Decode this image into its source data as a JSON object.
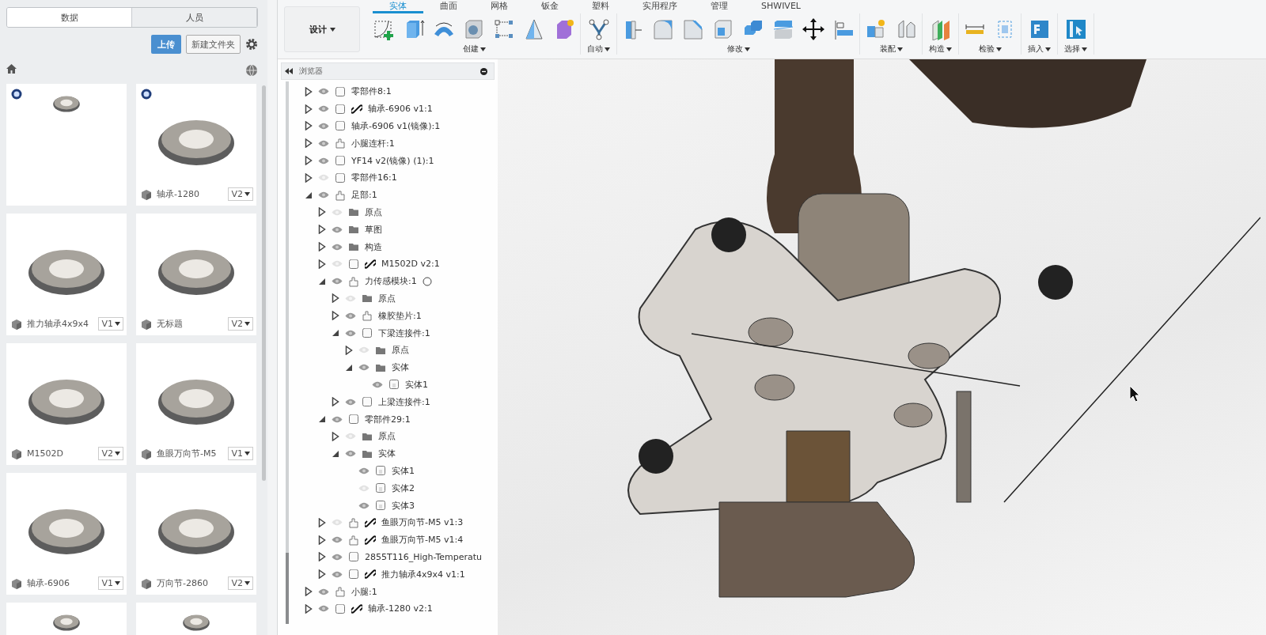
{
  "data_panel": {
    "tabs": [
      {
        "label": "数据",
        "selected": true
      },
      {
        "label": "人员",
        "selected": false
      }
    ],
    "upload_button": "上传",
    "new_folder_button": "新建文件夹",
    "cards": [
      {
        "badge": true
      },
      {
        "badge": true,
        "name": "轴承-1280",
        "version": "V2"
      },
      {
        "badge": false,
        "name": "推力轴承4x9x4",
        "version": "V1"
      },
      {
        "badge": false,
        "name": "无标题",
        "version": "V2"
      },
      {
        "badge": false,
        "name": "M1502D",
        "version": "V2"
      },
      {
        "badge": false,
        "name": "鱼眼万向节-M5",
        "version": "V1"
      },
      {
        "badge": false,
        "name": "轴承-6906",
        "version": "V1"
      },
      {
        "badge": false,
        "name": "万向节-2860",
        "version": "V2"
      },
      {
        "badge": false
      },
      {
        "badge": false
      }
    ]
  },
  "toolbar": {
    "workspace": "设计",
    "tabs": [
      {
        "label": "实体",
        "selected": true
      },
      {
        "label": "曲面",
        "selected": false
      },
      {
        "label": "网格",
        "selected": false
      },
      {
        "label": "钣金",
        "selected": false
      },
      {
        "label": "塑料",
        "selected": false
      },
      {
        "label": "实用程序",
        "selected": false
      },
      {
        "label": "管理",
        "selected": false
      },
      {
        "label": "SHWIVEL",
        "selected": false
      }
    ],
    "groups": [
      {
        "label": "创建"
      },
      {
        "label": "自动"
      },
      {
        "label": "修改"
      },
      {
        "label": "装配"
      },
      {
        "label": "构造"
      },
      {
        "label": "检验"
      },
      {
        "label": "插入"
      },
      {
        "label": "选择"
      }
    ]
  },
  "browser": {
    "title": "浏览器",
    "tree": [
      {
        "label": "零部件8:1",
        "kind": "body",
        "visible": true,
        "link": false,
        "expanded": false
      },
      {
        "label": "轴承-6906 v1:1",
        "kind": "body",
        "visible": true,
        "link": true,
        "expanded": false
      },
      {
        "label": "轴承-6906 v1(镜像):1",
        "kind": "body",
        "visible": true,
        "link": false,
        "expanded": false
      },
      {
        "label": "小腿连杆:1",
        "kind": "component",
        "visible": true,
        "link": false,
        "expanded": false
      },
      {
        "label": "YF14 v2(镜像) (1):1",
        "kind": "body",
        "visible": true,
        "link": false,
        "expanded": false
      },
      {
        "label": "零部件16:1",
        "kind": "body",
        "visible": false,
        "link": false,
        "expanded": false
      },
      {
        "label": "足部:1",
        "kind": "component",
        "visible": true,
        "link": false,
        "expanded": true,
        "children": [
          {
            "label": "原点",
            "kind": "folder",
            "visible": false,
            "link": false,
            "expanded": false
          },
          {
            "label": "草图",
            "kind": "folder",
            "visible": true,
            "link": false,
            "expanded": false
          },
          {
            "label": "构造",
            "kind": "folder",
            "visible": true,
            "link": false,
            "expanded": false
          },
          {
            "label": "M1502D v2:1",
            "kind": "body",
            "visible": false,
            "link": true,
            "expanded": false
          },
          {
            "label": "力传感模块:1",
            "kind": "component",
            "visible": true,
            "link": false,
            "expanded": true,
            "activated": false,
            "children": [
              {
                "label": "原点",
                "kind": "folder",
                "visible": false,
                "link": false,
                "expanded": false
              },
              {
                "label": "橡胶垫片:1",
                "kind": "component",
                "visible": true,
                "link": false,
                "expanded": false
              },
              {
                "label": "下梁连接件:1",
                "kind": "body",
                "visible": true,
                "link": false,
                "expanded": true,
                "children": [
                  {
                    "label": "原点",
                    "kind": "folder",
                    "visible": false,
                    "link": false,
                    "expanded": false
                  },
                  {
                    "label": "实体",
                    "kind": "folder",
                    "visible": true,
                    "link": false,
                    "expanded": true,
                    "children": [
                      {
                        "label": "实体1",
                        "kind": "solid",
                        "visible": true,
                        "link": false
                      }
                    ]
                  }
                ]
              },
              {
                "label": "上梁连接件:1",
                "kind": "body",
                "visible": true,
                "link": false,
                "expanded": false
              }
            ]
          },
          {
            "label": "零部件29:1",
            "kind": "body",
            "visible": true,
            "link": false,
            "expanded": true,
            "children": [
              {
                "label": "原点",
                "kind": "folder",
                "visible": false,
                "link": false,
                "expanded": false
              },
              {
                "label": "实体",
                "kind": "folder",
                "visible": true,
                "link": false,
                "expanded": true,
                "children": [
                  {
                    "label": "实体1",
                    "kind": "solid",
                    "visible": true,
                    "link": false
                  },
                  {
                    "label": "实体2",
                    "kind": "solid",
                    "visible": false,
                    "link": false
                  },
                  {
                    "label": "实体3",
                    "kind": "solid",
                    "visible": true,
                    "link": false
                  }
                ]
              }
            ]
          },
          {
            "label": "鱼眼万向节-M5 v1:3",
            "kind": "component",
            "visible": false,
            "link": true,
            "expanded": false
          },
          {
            "label": "鱼眼万向节-M5 v1:4",
            "kind": "component",
            "visible": true,
            "link": true,
            "expanded": false
          },
          {
            "label": "2855T116_High-Temperatu",
            "kind": "body",
            "visible": true,
            "link": false,
            "expanded": false
          },
          {
            "label": "推力轴承4x9x4 v1:1",
            "kind": "body",
            "visible": true,
            "link": true,
            "expanded": false
          }
        ]
      },
      {
        "label": "小腿:1",
        "kind": "component",
        "visible": true,
        "link": false,
        "expanded": false
      },
      {
        "label": "轴承-1280 v2:1",
        "kind": "body",
        "visible": true,
        "link": true,
        "expanded": false
      }
    ]
  }
}
